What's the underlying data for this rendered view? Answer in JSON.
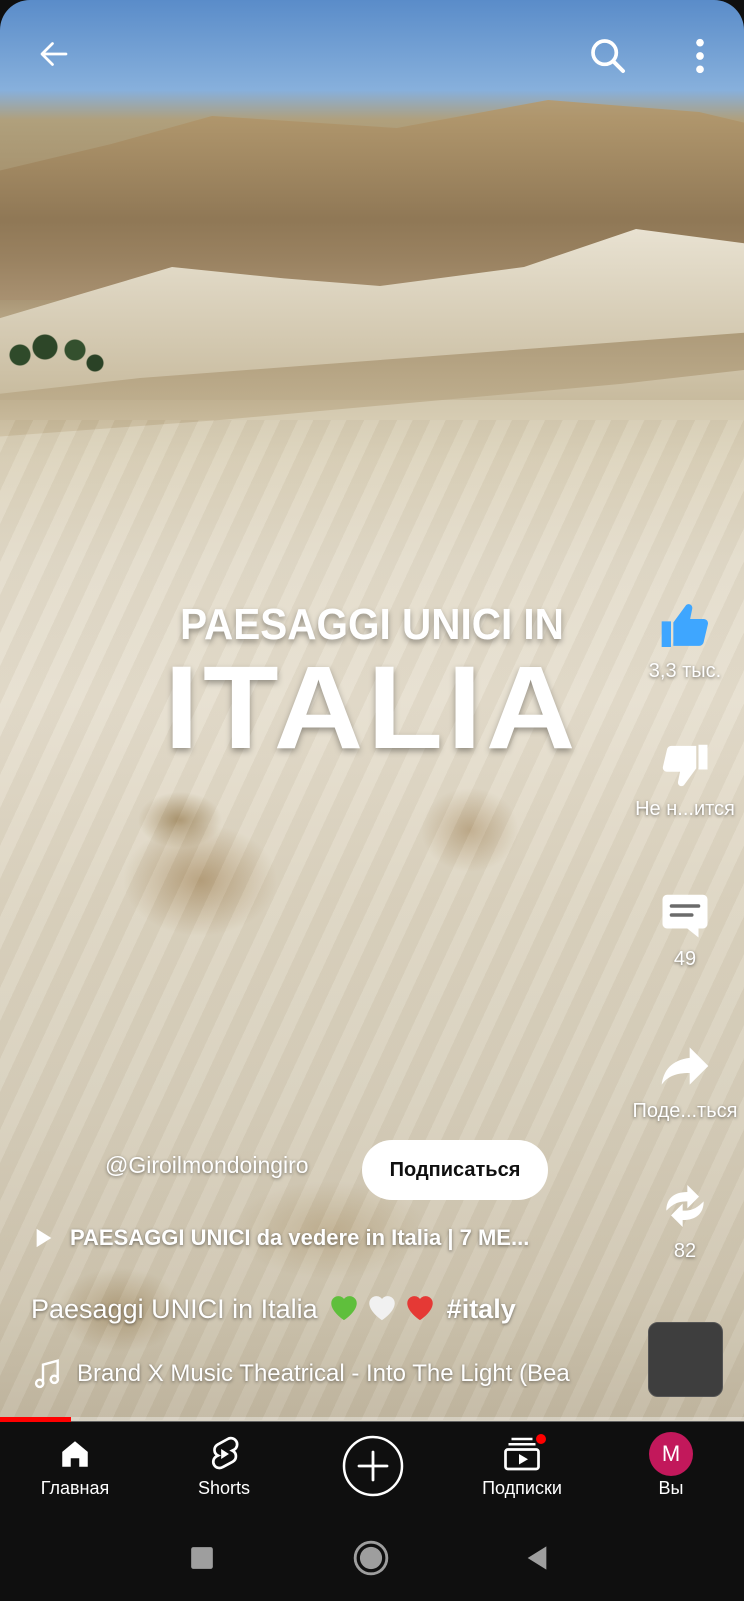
{
  "video": {
    "overlay_line1": "PAESAGGI UNICI IN",
    "overlay_line2": "ITALIA",
    "progress_fraction": 0.095
  },
  "topbar": {
    "back_icon": "arrow-left-icon",
    "search_icon": "search-icon",
    "more_icon": "more-vert-icon"
  },
  "actions": {
    "like_count": "3,3 тыс.",
    "dislike_label": "Не н...ится",
    "comments_count": "49",
    "share_label": "Поде...ться",
    "remix_count": "82"
  },
  "info": {
    "channel": "@Giroilmondoingiro",
    "subscribe_label": "Подписаться",
    "playlist": "PAESAGGI UNICI da vedere in Italia | 7 ME...",
    "title_text": "Paesaggi UNICI in Italia",
    "title_hashtag": "#italy",
    "music": "Brand X Music Theatrical - Into The Light (Bea"
  },
  "nav": {
    "home": "Главная",
    "shorts": "Shorts",
    "subscriptions": "Подписки",
    "you": "Вы",
    "avatar_letter": "M"
  },
  "colors": {
    "accent": "#ff0000",
    "avatar_bg": "#c2185b",
    "nav_bg": "#0f0f0f",
    "like_blue": "#3ea6ff"
  }
}
